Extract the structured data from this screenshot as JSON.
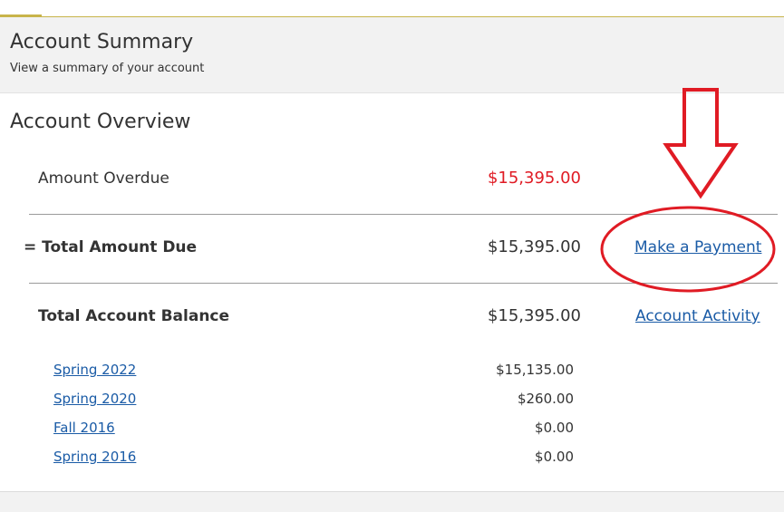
{
  "header": {
    "title": "Account Summary",
    "subtitle": "View a summary of your account"
  },
  "overview": {
    "title": "Account Overview",
    "amount_overdue": {
      "label": "Amount Overdue",
      "value": "$15,395.00"
    },
    "total_amount_due": {
      "label": "= Total Amount Due",
      "value": "$15,395.00",
      "action": "Make a Payment"
    },
    "total_account_balance": {
      "label": "Total Account Balance",
      "value": "$15,395.00",
      "action": "Account Activity"
    },
    "terms": [
      {
        "term": "Spring 2022",
        "amount": "$15,135.00"
      },
      {
        "term": "Spring 2020",
        "amount": "$260.00"
      },
      {
        "term": "Fall 2016",
        "amount": "$0.00"
      },
      {
        "term": "Spring 2016",
        "amount": "$0.00"
      }
    ]
  },
  "colors": {
    "overdue": "#e01b24",
    "link": "#1a5ba6",
    "annotation": "#e01b24",
    "accent": "#c8b44a"
  },
  "annotations": {
    "arrow": "down-arrow-annotation",
    "circle": "ellipse-highlight-annotation"
  }
}
